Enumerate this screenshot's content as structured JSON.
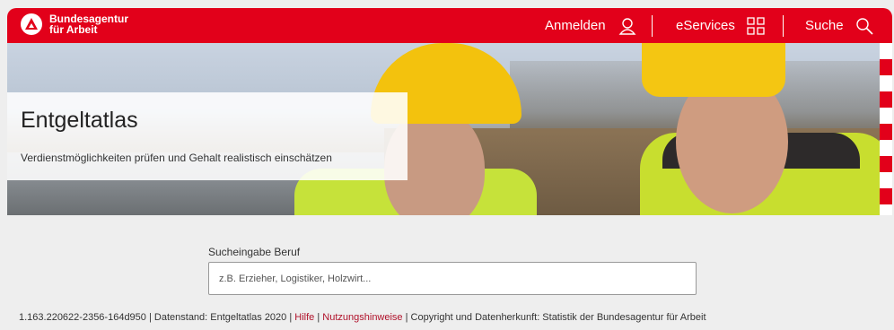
{
  "header": {
    "brand_line1": "Bundesagentur",
    "brand_line2": "für Arbeit",
    "login_label": "Anmelden",
    "eservices_label": "eServices",
    "search_label": "Suche",
    "accent_color": "#e2001a"
  },
  "hero": {
    "title": "Entgeltatlas",
    "subtitle": "Verdienstmöglichkeiten prüfen und Gehalt realistisch einschätzen"
  },
  "search": {
    "label": "Sucheingabe Beruf",
    "placeholder": "z.B. Erzieher, Logistiker, Holzwirt..."
  },
  "footer": {
    "version": "1.163.220622-2356-164d950",
    "datenstand": "Datenstand: Entgeltatlas 2020",
    "hilfe": "Hilfe",
    "nutzungshinweise": "Nutzungshinweise",
    "copyright": "Copyright und Datenherkunft: Statistik der Bundesagentur für Arbeit"
  }
}
